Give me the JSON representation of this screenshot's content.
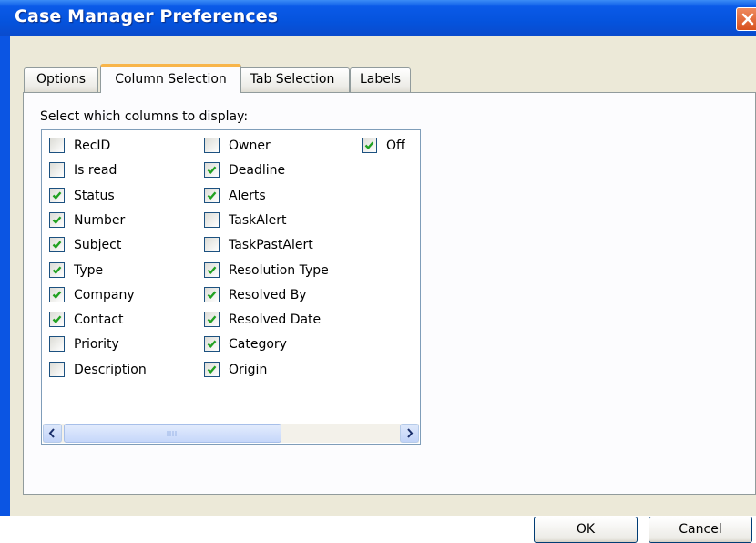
{
  "window": {
    "title": "Case Manager Preferences",
    "accent": "#0553dd",
    "face": "#ece9d8"
  },
  "tabs": [
    {
      "label": "Options",
      "active": false
    },
    {
      "label": "Column Selection",
      "active": true
    },
    {
      "label": "Tab Selection",
      "active": false
    },
    {
      "label": "Labels",
      "active": false
    }
  ],
  "column_selection": {
    "prompt": "Select which columns to display:",
    "columns": [
      [
        {
          "label": "RecID",
          "checked": false
        },
        {
          "label": "Is read",
          "checked": false
        },
        {
          "label": "Status",
          "checked": true
        },
        {
          "label": "Number",
          "checked": true
        },
        {
          "label": "Subject",
          "checked": true
        },
        {
          "label": "Type",
          "checked": true
        },
        {
          "label": "Company",
          "checked": true
        },
        {
          "label": "Contact",
          "checked": true
        },
        {
          "label": "Priority",
          "checked": false
        },
        {
          "label": "Description",
          "checked": false
        }
      ],
      [
        {
          "label": "Owner",
          "checked": false
        },
        {
          "label": "Deadline",
          "checked": true
        },
        {
          "label": "Alerts",
          "checked": true
        },
        {
          "label": "TaskAlert",
          "checked": false
        },
        {
          "label": "TaskPastAlert",
          "checked": false
        },
        {
          "label": "Resolution Type",
          "checked": true
        },
        {
          "label": "Resolved By",
          "checked": true
        },
        {
          "label": "Resolved Date",
          "checked": true
        },
        {
          "label": "Category",
          "checked": true
        },
        {
          "label": "Origin",
          "checked": true
        }
      ],
      [
        {
          "label": "Off",
          "checked": true
        }
      ]
    ]
  },
  "icons": {
    "close": "close-icon",
    "scroll_left": "arrow-left-icon",
    "scroll_right": "arrow-right-icon",
    "checkmark": "checkmark-icon",
    "grip": "scroll-grip-icon"
  },
  "buttons": {
    "ok_label": "OK",
    "cancel_label": "Cancel"
  }
}
